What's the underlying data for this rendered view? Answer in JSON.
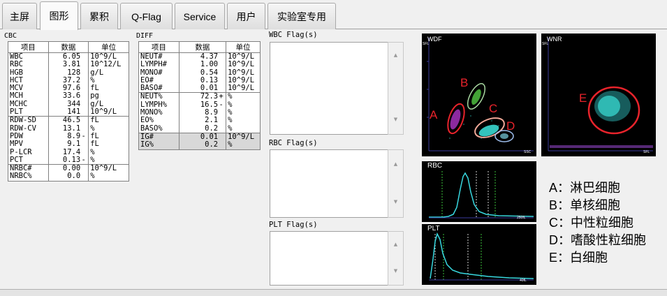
{
  "tabs": [
    {
      "label": "主屏"
    },
    {
      "label": "图形"
    },
    {
      "label": "累积"
    },
    {
      "label": "Q-Flag"
    },
    {
      "label": "Service"
    },
    {
      "label": "用户"
    },
    {
      "label": "实验室专用"
    }
  ],
  "cbc": {
    "title": "CBC",
    "headers": [
      "项目",
      "数据",
      "单位"
    ],
    "rows": [
      {
        "name": "WBC",
        "value": "6.05",
        "flag": "",
        "unit": "10^9/L"
      },
      {
        "name": "RBC",
        "value": "3.81",
        "flag": "",
        "unit": "10^12/L"
      },
      {
        "name": "HGB",
        "value": "128",
        "flag": "",
        "unit": "g/L"
      },
      {
        "name": "HCT",
        "value": "37.2",
        "flag": "",
        "unit": "%"
      },
      {
        "name": "MCV",
        "value": "97.6",
        "flag": "",
        "unit": "fL"
      },
      {
        "name": "MCH",
        "value": "33.6",
        "flag": "",
        "unit": "pg"
      },
      {
        "name": "MCHC",
        "value": "344",
        "flag": "",
        "unit": "g/L"
      },
      {
        "name": "PLT",
        "value": "141",
        "flag": "",
        "unit": "10^9/L"
      },
      {
        "name": "RDW-SD",
        "value": "46.5",
        "flag": "",
        "unit": "fL"
      },
      {
        "name": "RDW-CV",
        "value": "13.1",
        "flag": "",
        "unit": "%"
      },
      {
        "name": "PDW",
        "value": "8.9",
        "flag": "-",
        "unit": "fL"
      },
      {
        "name": "MPV",
        "value": "9.1",
        "flag": "",
        "unit": "fL"
      },
      {
        "name": "P-LCR",
        "value": "17.4",
        "flag": "",
        "unit": "%"
      },
      {
        "name": "PCT",
        "value": "0.13",
        "flag": "-",
        "unit": "%"
      },
      {
        "name": "NRBC#",
        "value": "0.00",
        "flag": "",
        "unit": "10^9/L"
      },
      {
        "name": "NRBC%",
        "value": "0.0",
        "flag": "",
        "unit": "%"
      }
    ]
  },
  "diff": {
    "title": "DIFF",
    "headers": [
      "项目",
      "数据",
      "单位"
    ],
    "rows": [
      {
        "name": "NEUT#",
        "value": "4.37",
        "flag": "",
        "unit": "10^9/L"
      },
      {
        "name": "LYMPH#",
        "value": "1.00",
        "flag": "",
        "unit": "10^9/L"
      },
      {
        "name": "MONO#",
        "value": "0.54",
        "flag": "",
        "unit": "10^9/L"
      },
      {
        "name": "EO#",
        "value": "0.13",
        "flag": "",
        "unit": "10^9/L"
      },
      {
        "name": "BASO#",
        "value": "0.01",
        "flag": "",
        "unit": "10^9/L"
      },
      {
        "name": "NEUT%",
        "value": "72.3",
        "flag": "+",
        "unit": "%"
      },
      {
        "name": "LYMPH%",
        "value": "16.5",
        "flag": "-",
        "unit": "%"
      },
      {
        "name": "MONO%",
        "value": "8.9",
        "flag": "",
        "unit": "%"
      },
      {
        "name": "EO%",
        "value": "2.1",
        "flag": "",
        "unit": "%"
      },
      {
        "name": "BASO%",
        "value": "0.2",
        "flag": "",
        "unit": "%"
      },
      {
        "name": "IG#",
        "value": "0.01",
        "flag": "",
        "unit": "10^9/L"
      },
      {
        "name": "IG%",
        "value": "0.2",
        "flag": "",
        "unit": "%"
      }
    ]
  },
  "flags": {
    "wbc_label": "WBC Flag(s)",
    "rbc_label": "RBC Flag(s)",
    "plt_label": "PLT Flag(s)",
    "scroll_up": "▲",
    "scroll_down": "▼"
  },
  "scattergrams": {
    "wdf": {
      "title": "WDF",
      "y_axis": "SFL",
      "x_axis": "SSC"
    },
    "wnr": {
      "title": "WNR",
      "y_axis": "SFL",
      "x_axis": "SFL"
    },
    "rbc": {
      "title": "RBC",
      "x_max": "250fL"
    },
    "plt": {
      "title": "PLT",
      "x_max": "40fL"
    },
    "annotations": [
      "A",
      "B",
      "C",
      "D",
      "E"
    ],
    "annotation_color": "#e8232b"
  },
  "legend": [
    "A：淋巴细胞",
    "B：单核细胞",
    "C：中性粒细胞",
    "D：嗜酸性粒细胞",
    "E：白细胞"
  ]
}
